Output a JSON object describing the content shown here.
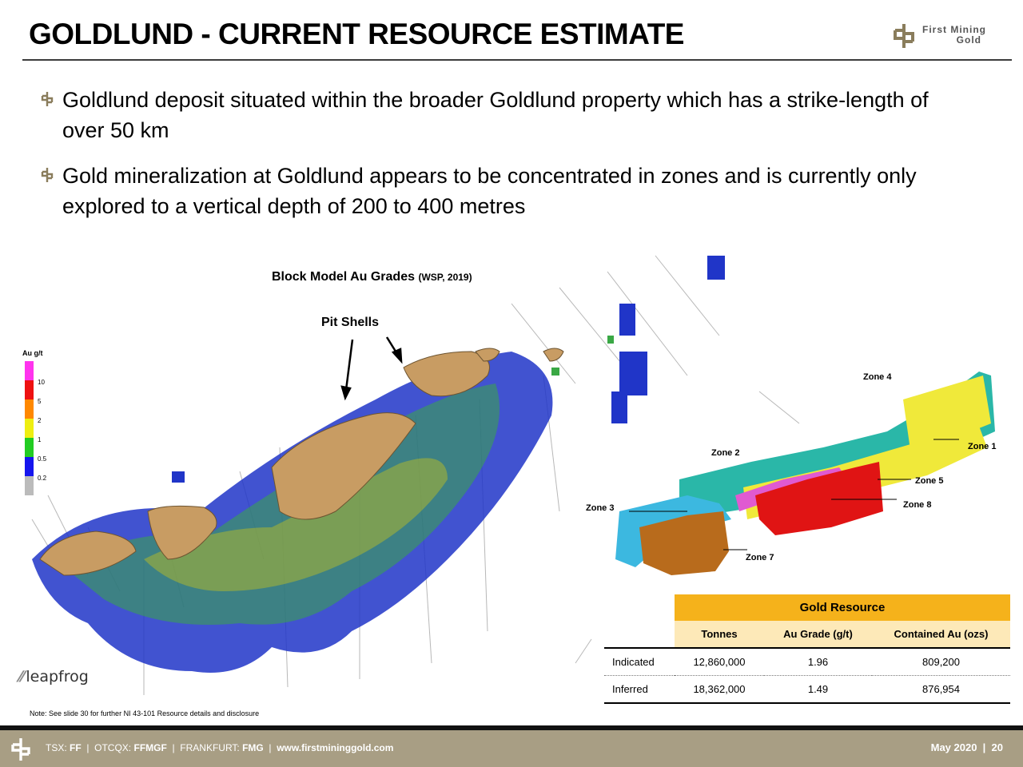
{
  "title": "GOLDLUND - CURRENT RESOURCE ESTIMATE",
  "logo": {
    "line1": "First Mining",
    "line2": "Gold"
  },
  "bullets": [
    "Goldlund deposit situated within the broader Goldlund property which has a strike-length of over 50 km",
    "Gold mineralization at Goldlund appears to be concentrated in zones and is currently only explored to a vertical depth of 200 to 400 metres"
  ],
  "figure": {
    "caption_main": "Block Model Au Grades",
    "caption_source": "(WSP, 2019)",
    "pit_shells_label": "Pit Shells",
    "legend": {
      "title": "Au g/t",
      "values": [
        "10",
        "5",
        "2",
        "1",
        "0.5",
        "0.2"
      ]
    },
    "zones": [
      "Zone 4",
      "Zone 1",
      "Zone 2",
      "Zone 5",
      "Zone 3",
      "Zone 8",
      "Zone 7"
    ],
    "software_logo": "leapfrog"
  },
  "resource_table": {
    "title": "Gold Resource",
    "columns": [
      "Tonnes",
      "Au Grade (g/t)",
      "Contained Au (ozs)"
    ],
    "rows": [
      {
        "category": "Indicated",
        "tonnes": "12,860,000",
        "grade": "1.96",
        "ounces": "809,200"
      },
      {
        "category": "Inferred",
        "tonnes": "18,362,000",
        "grade": "1.49",
        "ounces": "876,954"
      }
    ]
  },
  "note": "Note: See slide 30 for further NI 43-101 Resource details and disclosure",
  "footer": {
    "tsx_label": "TSX:",
    "tsx": "FF",
    "otcqx_label": "OTCQX:",
    "otcqx": "FFMGF",
    "frankfurt_label": "FRANKFURT:",
    "frankfurt": "FMG",
    "website": "www.firstmininggold.com",
    "date": "May 2020",
    "page": "20"
  },
  "colors": {
    "accent_gold": "#f5b21b",
    "footer_bg": "#a89e84",
    "rule": "#3c3c3c"
  }
}
